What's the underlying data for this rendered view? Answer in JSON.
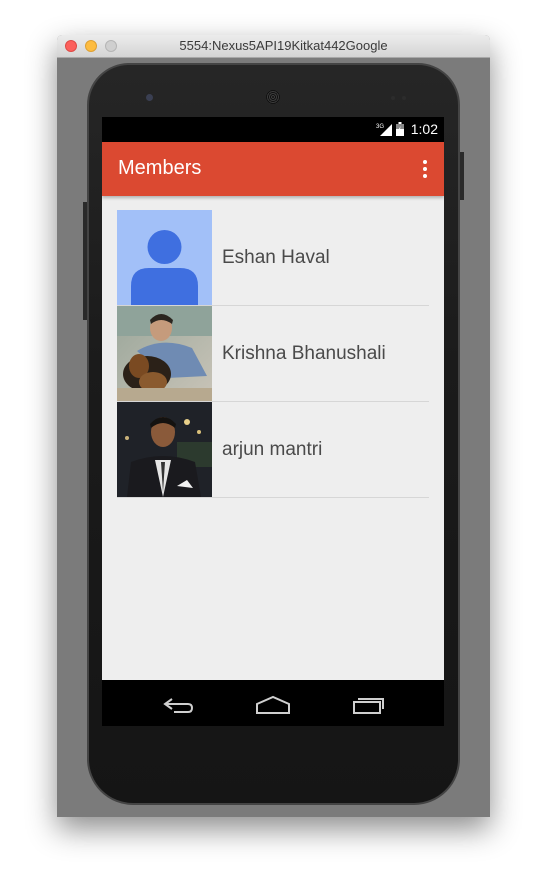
{
  "window": {
    "title": "5554:Nexus5API19Kitkat442Google"
  },
  "status_bar": {
    "network": "3G",
    "time": "1:02"
  },
  "app_bar": {
    "title": "Members",
    "overflow_icon": "more-vert-icon"
  },
  "members": [
    {
      "name": "Eshan Haval",
      "avatar": "default-person-avatar"
    },
    {
      "name": "Krishna Bhanushali",
      "avatar": "photo-avatar"
    },
    {
      "name": "arjun mantri",
      "avatar": "photo-avatar"
    }
  ],
  "nav_bar": {
    "buttons": [
      "back-icon",
      "home-icon",
      "recents-icon"
    ]
  },
  "colors": {
    "primary": "#db4931",
    "background": "#eeeeee",
    "avatar_default_bg": "#a2c0f8",
    "avatar_default_fg": "#3f6fe0"
  }
}
